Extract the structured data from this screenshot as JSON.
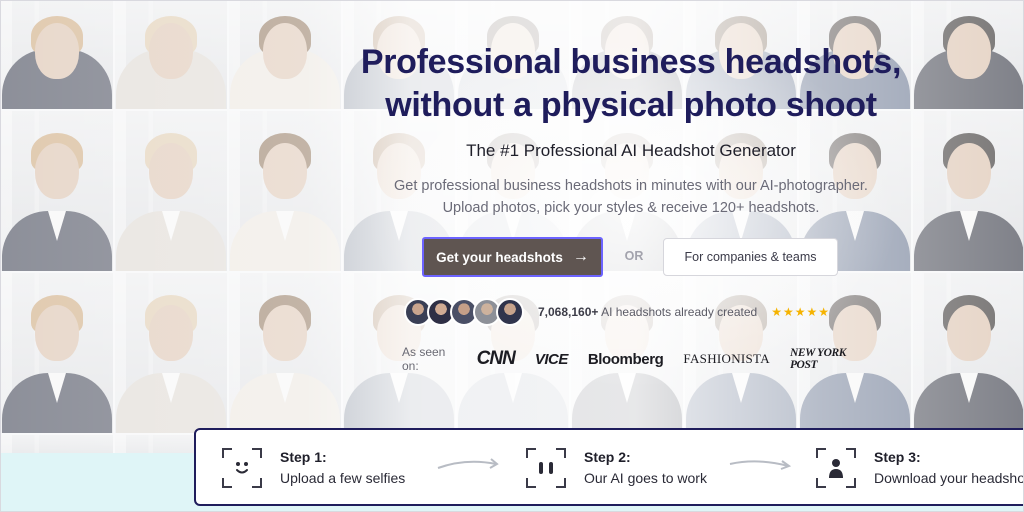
{
  "hero": {
    "headline_line1": "Professional business headshots,",
    "headline_line2": "without a physical photo shoot",
    "subtitle": "The #1 Professional AI Headshot Generator",
    "description": "Get professional business headshots in minutes with our AI-photographer. Upload photos, pick your styles & receive 120+ headshots."
  },
  "cta": {
    "primary_label": "Get your headshots",
    "primary_icon": "arrow-right-icon",
    "or_label": "OR",
    "secondary_label": "For companies & teams"
  },
  "stats": {
    "count": "7,068,160+",
    "count_suffix": "AI headshots already created",
    "rating_stars": 5
  },
  "press": {
    "label": "As seen on:",
    "logos": [
      "CNN",
      "VICE",
      "Bloomberg",
      "FASHIONISTA",
      "NEW YORK POST"
    ]
  },
  "steps": [
    {
      "title": "Step 1:",
      "subtitle": "Upload a few selfies",
      "icon": "selfie-face-icon"
    },
    {
      "title": "Step 2:",
      "subtitle": "Our AI goes to work",
      "icon": "ai-eyes-icon"
    },
    {
      "title": "Step 3:",
      "subtitle": "Download your headshots",
      "icon": "person-download-icon"
    }
  ],
  "colors": {
    "headline": "#1f1d5c",
    "primary_button": "#5f5551",
    "primary_button_border": "#6c63ff",
    "star": "#f5b301",
    "bottom_band": "#dff5f7"
  }
}
